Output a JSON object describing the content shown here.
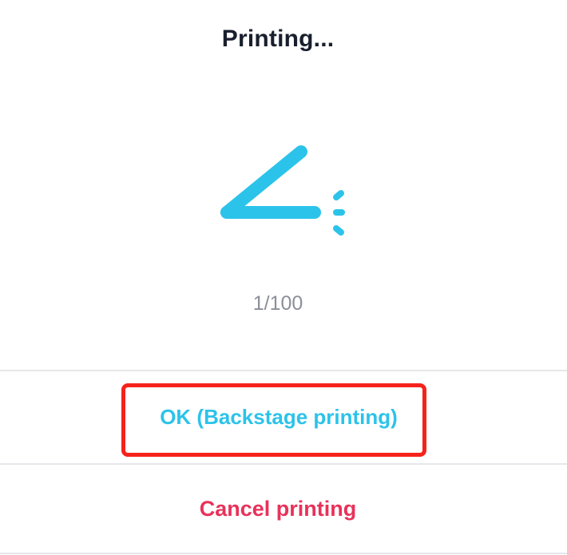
{
  "dialog": {
    "title": "Printing...",
    "progress_text": "1/100",
    "ok_button_label": "OK (Backstage printing)",
    "cancel_button_label": "Cancel printing",
    "icon": "printing-icon"
  },
  "colors": {
    "accent": "#2cc3ea",
    "cancel": "#e8325a",
    "title": "#1a1f2e",
    "muted_text": "#8a8f99",
    "highlight": "#f5231b"
  }
}
